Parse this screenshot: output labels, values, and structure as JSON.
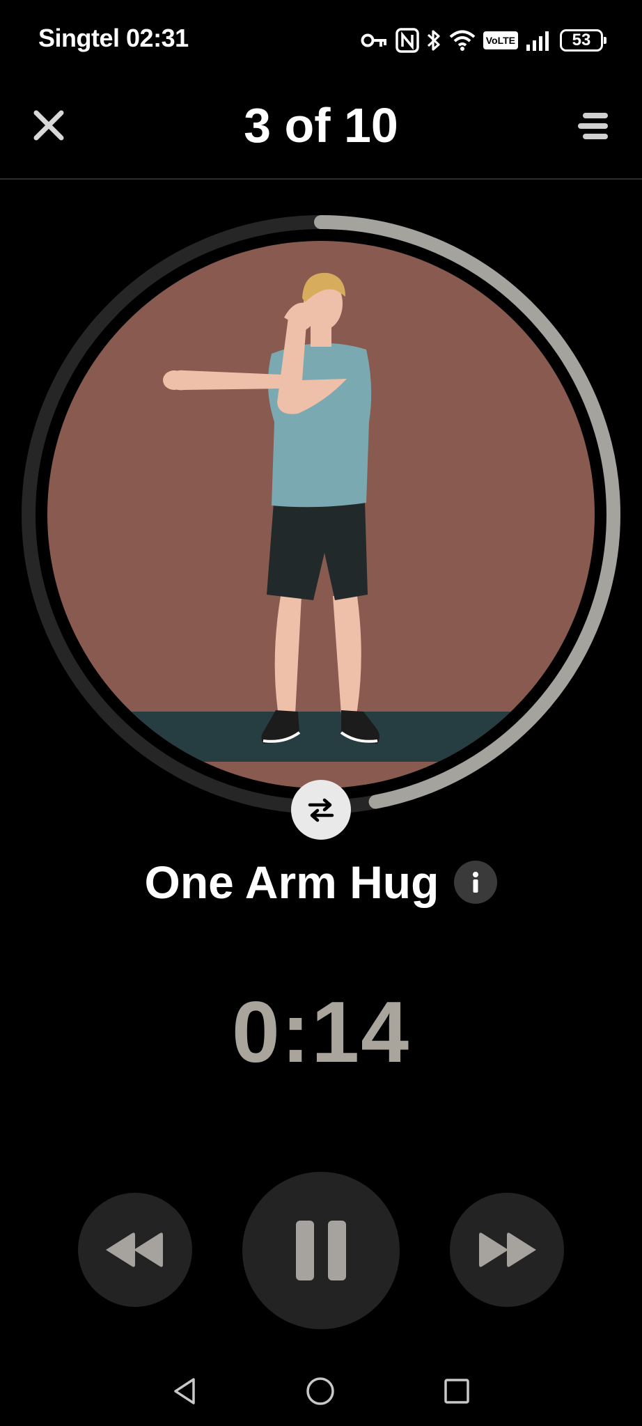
{
  "status_bar": {
    "carrier": "Singtel",
    "time": "02:31",
    "battery": "53",
    "icons": [
      "key-icon",
      "nfc-icon",
      "bluetooth-icon",
      "wifi-icon",
      "volte-icon",
      "signal-icon",
      "battery-icon"
    ],
    "volte_label": "VoLTE"
  },
  "header": {
    "title": "3 of 10",
    "close_icon": "close-icon",
    "menu_icon": "menu-icon"
  },
  "exercise": {
    "name": "One Arm Hug",
    "info_icon": "info-icon",
    "swap_icon": "swap-arrows-icon",
    "progress_fraction": 0.47,
    "colors": {
      "background": "#885a50",
      "floor": "#263e42",
      "ring_track": "#262626",
      "ring_progress": "#a5a39d",
      "shirt": "#7aa9b1",
      "shorts": "#22292a",
      "skin": "#eec0a9",
      "hair": "#d7ac5c"
    }
  },
  "timer": {
    "value": "0:14",
    "color": "#a9a59d"
  },
  "controls": {
    "rewind_icon": "rewind-icon",
    "pause_icon": "pause-icon",
    "forward_icon": "fast-forward-icon"
  },
  "nav": {
    "back_icon": "back-triangle-icon",
    "home_icon": "home-circle-icon",
    "recents_icon": "recents-square-icon"
  }
}
